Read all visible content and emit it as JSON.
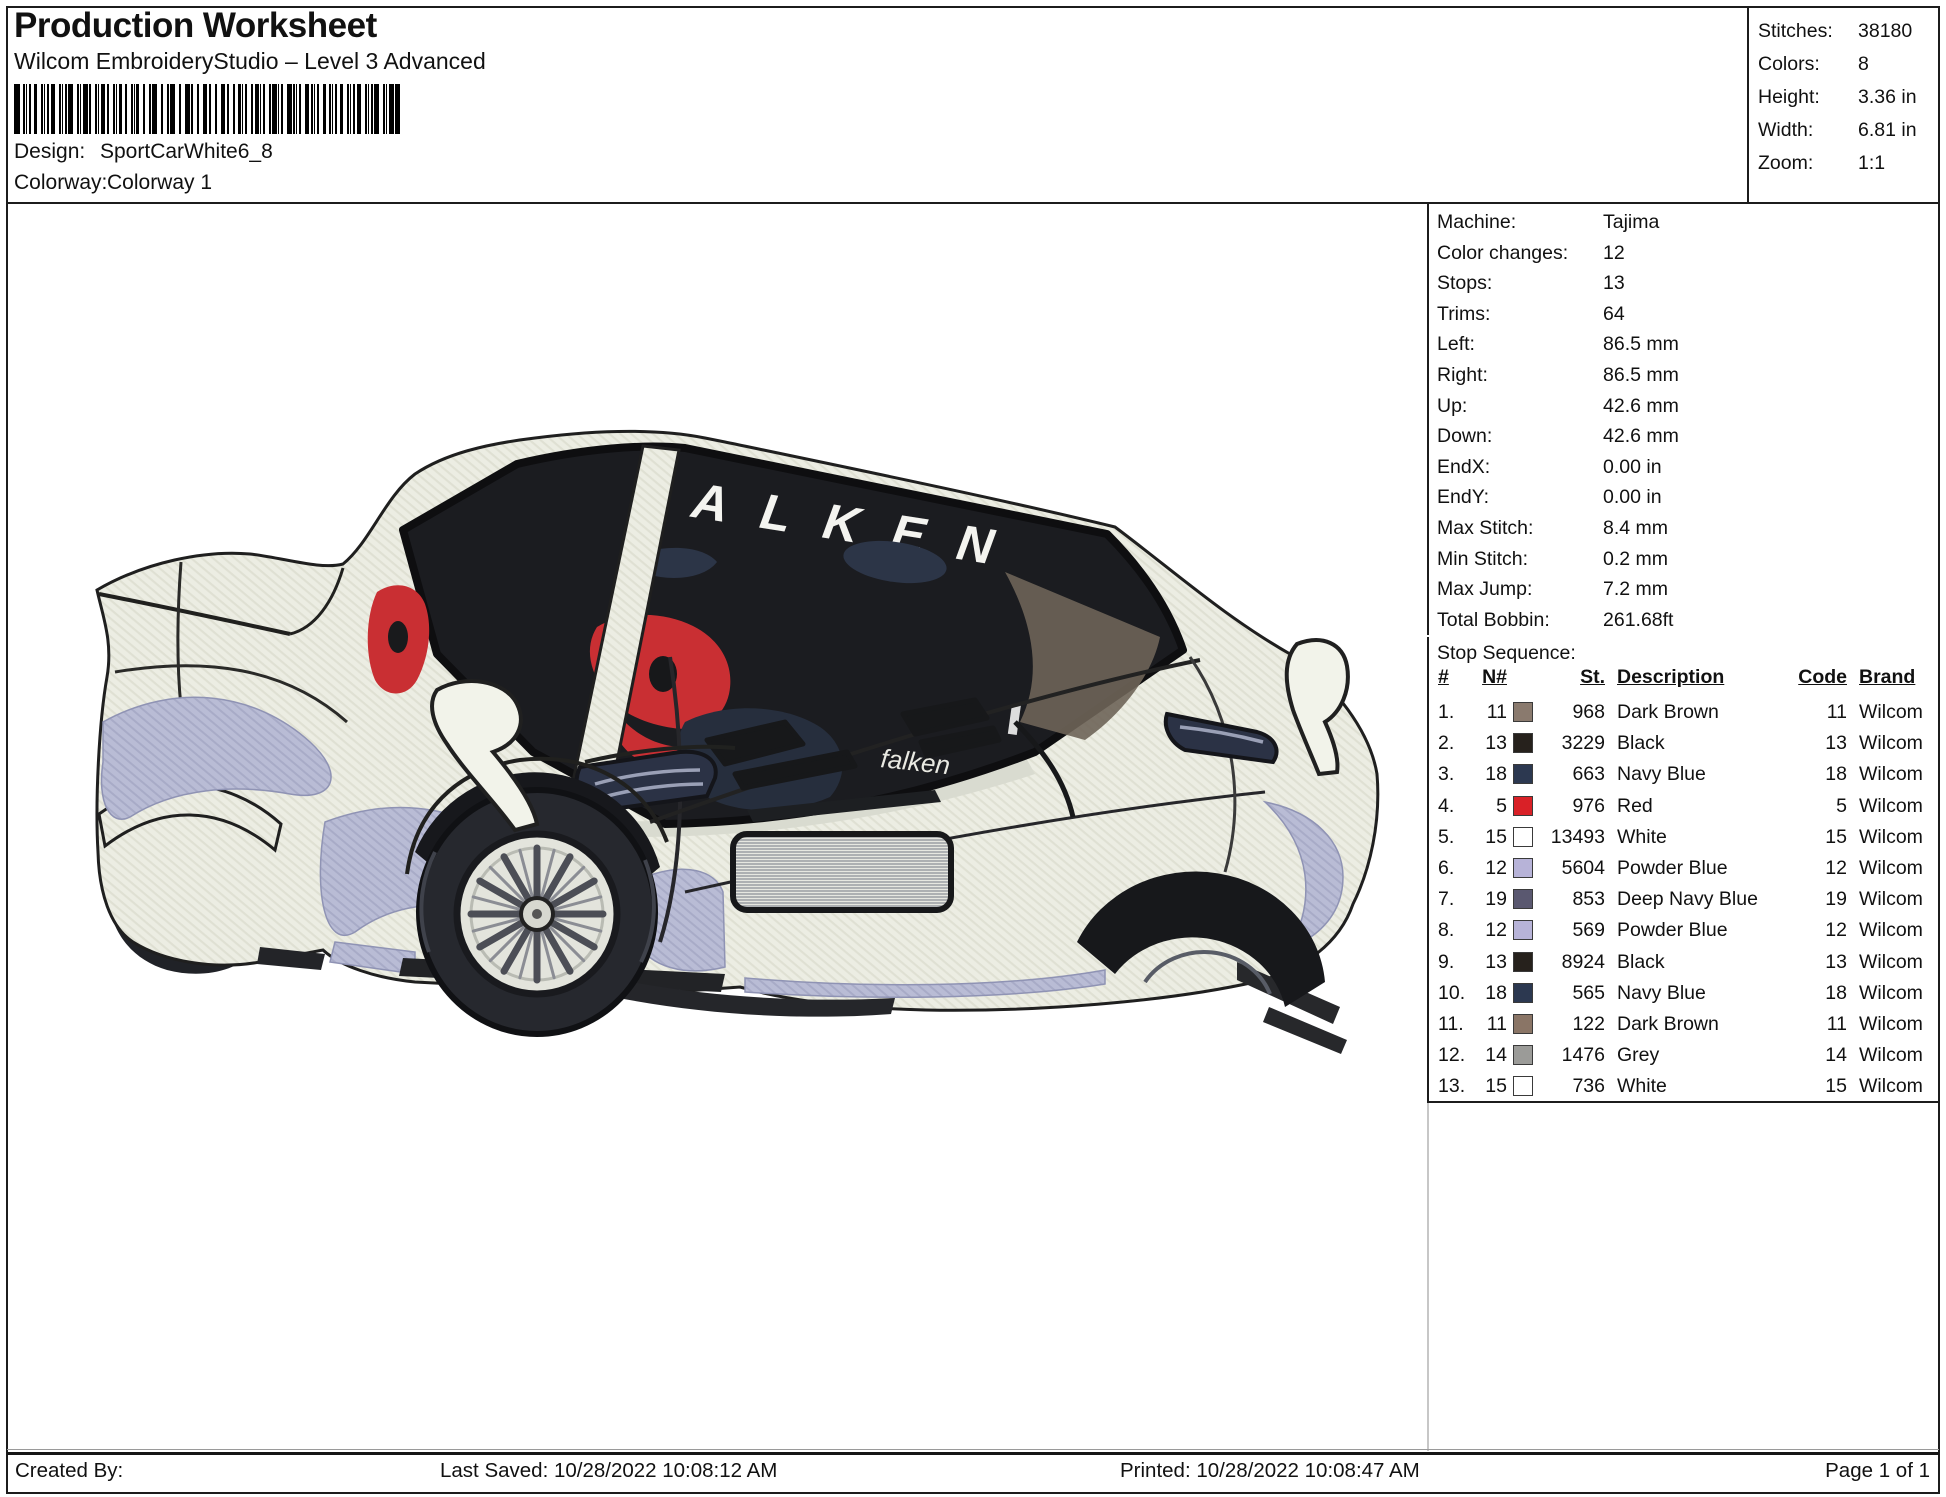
{
  "header": {
    "title": "Production Worksheet",
    "subtitle": "Wilcom EmbroideryStudio – Level 3 Advanced",
    "barcode_icon": "code128-barcode",
    "design_label": "Design:",
    "design_value": "SportCarWhite6_8",
    "colorway_label": "Colorway:",
    "colorway_value": "Colorway 1"
  },
  "stats": {
    "rows": [
      {
        "label": "Stitches:",
        "value": "38180"
      },
      {
        "label": "Colors:",
        "value": "8"
      },
      {
        "label": "Height:",
        "value": "3.36 in"
      },
      {
        "label": "Width:",
        "value": "6.81 in"
      },
      {
        "label": "Zoom:",
        "value": "1:1"
      }
    ]
  },
  "machine_info": {
    "rows": [
      {
        "label": "Machine:",
        "value": "Tajima"
      },
      {
        "label": "Color changes:",
        "value": "12"
      },
      {
        "label": "Stops:",
        "value": "13"
      },
      {
        "label": "Trims:",
        "value": "64"
      },
      {
        "label": "Left:",
        "value": "86.5 mm"
      },
      {
        "label": "Right:",
        "value": "86.5 mm"
      },
      {
        "label": "Up:",
        "value": "42.6 mm"
      },
      {
        "label": "Down:",
        "value": "42.6 mm"
      },
      {
        "label": "EndX:",
        "value": "0.00 in"
      },
      {
        "label": "EndY:",
        "value": "0.00 in"
      },
      {
        "label": "Max Stitch:",
        "value": "8.4 mm"
      },
      {
        "label": "Min Stitch:",
        "value": "0.2 mm"
      },
      {
        "label": "Max Jump:",
        "value": "7.2 mm"
      },
      {
        "label": "Total Bobbin:",
        "value": "261.68ft"
      }
    ]
  },
  "stop_sequence": {
    "title": "Stop Sequence:",
    "columns": [
      "#",
      "N#",
      "St.",
      "Description",
      "Code",
      "Brand"
    ],
    "rows": [
      {
        "num": "1.",
        "needle": "11",
        "swatch": "#8a7a6e",
        "stitches": "968",
        "description": "Dark Brown",
        "code": "11",
        "brand": "Wilcom"
      },
      {
        "num": "2.",
        "needle": "13",
        "swatch": "#26211c",
        "stitches": "3229",
        "description": "Black",
        "code": "13",
        "brand": "Wilcom"
      },
      {
        "num": "3.",
        "needle": "18",
        "swatch": "#2c3850",
        "stitches": "663",
        "description": "Navy Blue",
        "code": "18",
        "brand": "Wilcom"
      },
      {
        "num": "4.",
        "needle": "5",
        "swatch": "#d92127",
        "stitches": "976",
        "description": "Red",
        "code": "5",
        "brand": "Wilcom"
      },
      {
        "num": "5.",
        "needle": "15",
        "swatch": "#ffffff",
        "stitches": "13493",
        "description": "White",
        "code": "15",
        "brand": "Wilcom"
      },
      {
        "num": "6.",
        "needle": "12",
        "swatch": "#b7b3d8",
        "stitches": "5604",
        "description": "Powder Blue",
        "code": "12",
        "brand": "Wilcom"
      },
      {
        "num": "7.",
        "needle": "19",
        "swatch": "#5a5870",
        "stitches": "853",
        "description": "Deep Navy Blue",
        "code": "19",
        "brand": "Wilcom"
      },
      {
        "num": "8.",
        "needle": "12",
        "swatch": "#b7b3d8",
        "stitches": "569",
        "description": "Powder Blue",
        "code": "12",
        "brand": "Wilcom"
      },
      {
        "num": "9.",
        "needle": "13",
        "swatch": "#26211c",
        "stitches": "8924",
        "description": "Black",
        "code": "13",
        "brand": "Wilcom"
      },
      {
        "num": "10.",
        "needle": "18",
        "swatch": "#2c3850",
        "stitches": "565",
        "description": "Navy Blue",
        "code": "18",
        "brand": "Wilcom"
      },
      {
        "num": "11.",
        "needle": "11",
        "swatch": "#8a7566",
        "stitches": "122",
        "description": "Dark Brown",
        "code": "11",
        "brand": "Wilcom"
      },
      {
        "num": "12.",
        "needle": "14",
        "swatch": "#9b9b98",
        "stitches": "1476",
        "description": "Grey",
        "code": "14",
        "brand": "Wilcom"
      },
      {
        "num": "13.",
        "needle": "15",
        "swatch": "#ffffff",
        "stitches": "736",
        "description": "White",
        "code": "15",
        "brand": "Wilcom"
      }
    ]
  },
  "design_art": {
    "windshield_banner": "FALKEN",
    "glass_signature": "falken",
    "palette": {
      "body": "#ecede3",
      "accent_powder_blue": "#b9bcd5",
      "seat_red": "#c92f33",
      "glass": "#1b1c20",
      "tire": "#26282e",
      "rim": "#e3e4dc"
    }
  },
  "footer": {
    "created_by": "Created By:",
    "last_saved": "Last Saved: 10/28/2022 10:08:12 AM",
    "printed": "Printed: 10/28/2022 10:08:47 AM",
    "page": "Page 1 of 1"
  }
}
